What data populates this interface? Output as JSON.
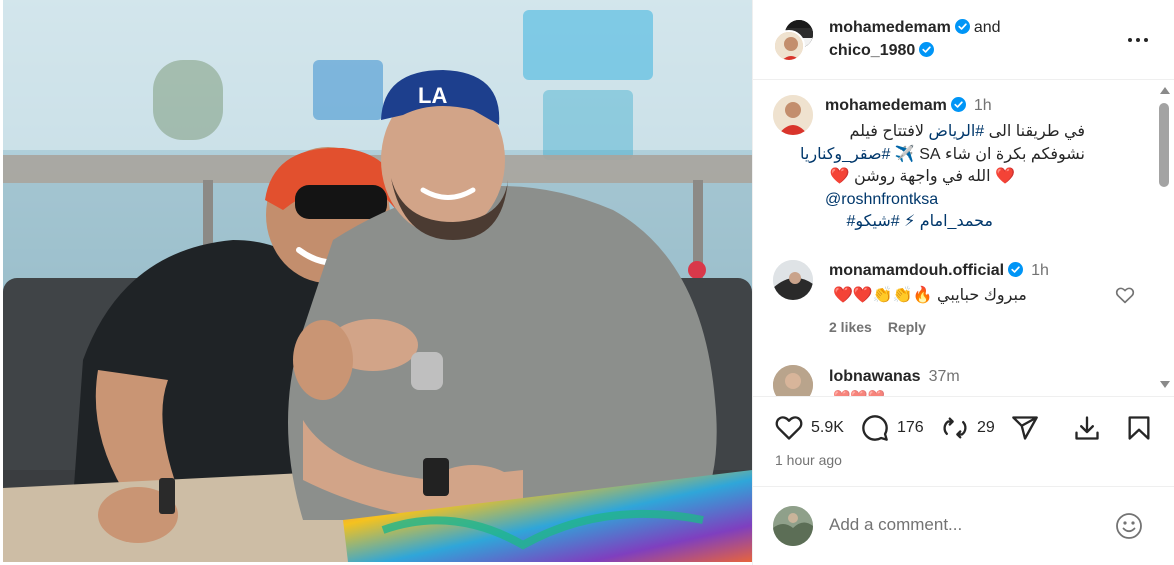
{
  "header": {
    "user1": "mohamedemam",
    "and_label": "and",
    "user2": "chico_1980",
    "more_icon": "more-horizontal-icon"
  },
  "caption": {
    "username": "mohamedemam",
    "time": "1h",
    "line1_text": "في طريقنا الى ",
    "line1_link": "#الرياض",
    "line1_rest": " لافتتاح فيلم",
    "line2_text": "نشوفكم بكرة ان شاء SA ✈️ ",
    "line2_link": "#صقر_وكناريا",
    "line3": "❤️ الله في واجهة روشن ❤️",
    "line4": "@roshnfrontksa",
    "line5_a": "محمد_امام",
    "line5_b": "⚡ #شيكو#"
  },
  "comments": [
    {
      "username": "monamamdouh.official",
      "time": "1h",
      "text": "مبروك حبايبي 🔥👏👏❤️❤️",
      "likes": "2 likes",
      "reply": "Reply"
    },
    {
      "username": "lobnawanas",
      "time": "37m",
      "text": "❤️❤️❤️"
    }
  ],
  "actions": {
    "likes": "5.9K",
    "comments": "176",
    "reposts": "29"
  },
  "posted": "1 hour ago",
  "comment_box": {
    "placeholder": "Add a comment..."
  },
  "colors": {
    "verified": "#0095f6",
    "link": "#00376b",
    "muted": "#737373",
    "text": "#262626"
  }
}
